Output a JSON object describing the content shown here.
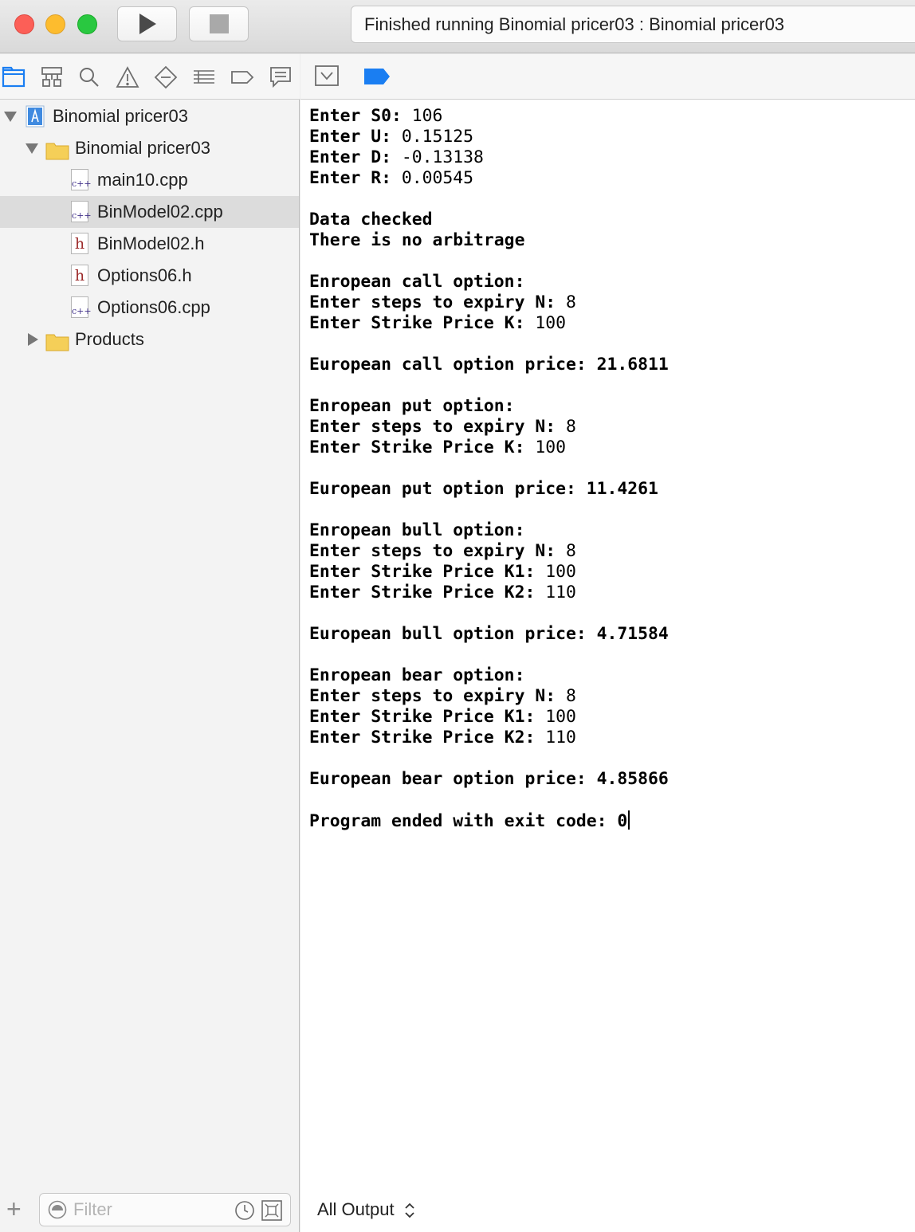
{
  "window": {
    "activity_text": "Finished running Binomial pricer03 : Binomial pricer03"
  },
  "toolbar": {
    "run_icon": "play-icon",
    "stop_icon": "stop-icon"
  },
  "navigator": {
    "tabs": [
      "folder-icon",
      "hierarchy-icon",
      "search-icon",
      "warning-icon",
      "test-diamond-icon",
      "debug-list-icon",
      "breakpoint-icon",
      "report-icon"
    ],
    "tree": [
      {
        "label": "Binomial pricer03",
        "kind": "project",
        "expanded": true
      },
      {
        "label": "Binomial pricer03",
        "kind": "folder",
        "expanded": true
      },
      {
        "label": "main10.cpp",
        "kind": "cpp"
      },
      {
        "label": "BinModel02.cpp",
        "kind": "cpp",
        "selected": true
      },
      {
        "label": "BinModel02.h",
        "kind": "h"
      },
      {
        "label": "Options06.h",
        "kind": "h"
      },
      {
        "label": "Options06.cpp",
        "kind": "cpp"
      },
      {
        "label": "Products",
        "kind": "folder",
        "expanded": false
      }
    ],
    "file_glyphs": {
      "cpp": "c++",
      "h": "h"
    },
    "filter_placeholder": "Filter",
    "add_symbol": "+"
  },
  "console": {
    "lines": [
      {
        "prompt": "Enter S0: ",
        "input": "106"
      },
      {
        "prompt": "Enter U: ",
        "input": "0.15125"
      },
      {
        "prompt": "Enter D: ",
        "input": "-0.13138"
      },
      {
        "prompt": "Enter R: ",
        "input": "0.00545"
      },
      {
        "prompt": "",
        "input": ""
      },
      {
        "prompt": "Data checked",
        "input": ""
      },
      {
        "prompt": "There is no arbitrage",
        "input": ""
      },
      {
        "prompt": "",
        "input": ""
      },
      {
        "prompt": "Enropean call option:",
        "input": ""
      },
      {
        "prompt": "Enter steps to expiry N: ",
        "input": "8"
      },
      {
        "prompt": "Enter Strike Price K: ",
        "input": "100"
      },
      {
        "prompt": "",
        "input": ""
      },
      {
        "prompt": "European call option price: 21.6811",
        "input": ""
      },
      {
        "prompt": "",
        "input": ""
      },
      {
        "prompt": "Enropean put option:",
        "input": ""
      },
      {
        "prompt": "Enter steps to expiry N: ",
        "input": "8"
      },
      {
        "prompt": "Enter Strike Price K: ",
        "input": "100"
      },
      {
        "prompt": "",
        "input": ""
      },
      {
        "prompt": "European put option price: 11.4261",
        "input": ""
      },
      {
        "prompt": "",
        "input": ""
      },
      {
        "prompt": "Enropean bull option:",
        "input": ""
      },
      {
        "prompt": "Enter steps to expiry N: ",
        "input": "8"
      },
      {
        "prompt": "Enter Strike Price K1: ",
        "input": "100"
      },
      {
        "prompt": "Enter Strike Price K2: ",
        "input": "110"
      },
      {
        "prompt": "",
        "input": ""
      },
      {
        "prompt": "European bull option price: 4.71584",
        "input": ""
      },
      {
        "prompt": "",
        "input": ""
      },
      {
        "prompt": "Enropean bear option:",
        "input": ""
      },
      {
        "prompt": "Enter steps to expiry N: ",
        "input": "8"
      },
      {
        "prompt": "Enter Strike Price K1: ",
        "input": "100"
      },
      {
        "prompt": "Enter Strike Price K2: ",
        "input": "110"
      },
      {
        "prompt": "",
        "input": ""
      },
      {
        "prompt": "European bear option price: 4.85866",
        "input": ""
      },
      {
        "prompt": "",
        "input": ""
      },
      {
        "prompt": "Program ended with exit code: 0",
        "input": "",
        "cursor": true
      }
    ],
    "output_filter": "All Output"
  },
  "colors": {
    "close": "#fc5f57",
    "minimize": "#fdbc2e",
    "zoom": "#29c840",
    "accent": "#1a7ef2",
    "folder": "#f5cf58"
  }
}
